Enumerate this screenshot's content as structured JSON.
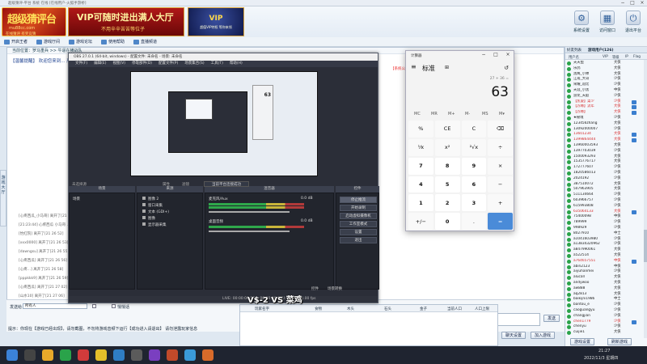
{
  "window": {
    "title": "超级猜评-平台 系统 在线 [在线用户-火狐手游桥]"
  },
  "banner": {
    "logo_title": "超级猜评台",
    "logo_sub": "在线猜评 有奖竞猜",
    "logo_url": "mu88cc.com",
    "ad1_title": "VIP可随时进出满人大厅",
    "ad1_sub": "不用辛辛苦苦等位子",
    "ad2_title": "VIP",
    "ad2_sub": "超值VIP特权 等你来领"
  },
  "topbuttons": [
    "开启王者",
    "游戏厅间",
    "游戏论坛",
    "使用帮助",
    "直播频道"
  ],
  "righttools": [
    {
      "label": "系统设置",
      "icon": "⚙"
    },
    {
      "label": "访问窗口",
      "icon": "▦"
    },
    {
      "label": "退出平台",
      "icon": "⏻"
    }
  ],
  "chat": {
    "breadcrumb": "当前位置：罗马重兵  >>  牛逼在横战队",
    "system_notice": "【温馨提醒】 欢迎您来到... 严禁赌博诈骗...",
    "red_notice": "【系统公告】 ...本平台严禁任何涉赌... 你好 你好，欢迎光临",
    "messages": [
      "[心疼西瓜_小马哥] 离开了[21 26 44]",
      "[21:23:44] 心疼西瓜 小马哥 ...",
      "[怡红院] 离开了[21 26 52]",
      "[xxx0000]  离开了[21 26 53]",
      "[dawngsu] 离开了[21 26 55]",
      "[心疼西瓜] 离开了[21 26 56]",
      "[心疼...] 离开了[21 26 58]",
      "[pppkkk9] 离开了[21 26 59]",
      "[心疼西瓜] 离开了[21 27 02]",
      "[山水10] 离开了[21 27 06]",
      "[一把刀10] 离开了[21 27 08]",
      "[山水10] 离开了[21 27 09]",
      "[玩玩了] 离开了[21 27 12]"
    ]
  },
  "sidetab_label": "游戏大厅",
  "input": {
    "send_to_label": "发送给：",
    "send_to_value": "所有人",
    "whisper_label": "悄悄话",
    "send_button": "发送",
    "hint": "提示：你现在【游戏已经出现】，请勿截图，不勿将游戏音频下运行【成功进入请退出】 请勿泄露玩家信息",
    "btn_emote": "表情",
    "btn_settings": "聊天设置",
    "btn_join": "加入游戏"
  },
  "bottompane": {
    "headers": [
      "玩家名字",
      "食物",
      "木头",
      "石头",
      "金子",
      "当前人口",
      "人口上限"
    ]
  },
  "right": {
    "tabs": [
      "好友列表",
      "游戏用户(126)"
    ],
    "headers": [
      "用户名",
      "VIP",
      "等级",
      "IP",
      "Flag"
    ],
    "users": [
      {
        "name": "天天鱼",
        "level": "大侠",
        "vip": false
      },
      {
        "name": "乐鸽",
        "level": "大侠",
        "vip": false
      },
      {
        "name": "黑鹰_小帅",
        "level": "大侠",
        "vip": false
      },
      {
        "name": "江南_大哥",
        "level": "少侠",
        "vip": false
      },
      {
        "name": "荣耀_逗比",
        "level": "少侠",
        "vip": false
      },
      {
        "name": "天涯_小黑",
        "level": "中侠",
        "vip": false
      },
      {
        "name": "游龙_天庭",
        "level": "少侠",
        "vip": false
      },
      {
        "name": "【凯旋】菜少",
        "level": "少侠",
        "vip": true
      },
      {
        "name": "【苏缘】流年",
        "level": "大侠",
        "vip": true
      },
      {
        "name": "【苏缘】",
        "level": "大侠",
        "vip": true
      },
      {
        "name": "★秘境",
        "level": "少侠",
        "vip": false
      },
      {
        "name": "123456zhang",
        "level": "大侠",
        "vip": false
      },
      {
        "name": "13092000007",
        "level": "少侠",
        "vip": false
      },
      {
        "name": "13601234",
        "level": "大侠",
        "vip": true
      },
      {
        "name": "1399864444",
        "level": "大侠",
        "vip": true
      },
      {
        "name": "13960003593",
        "level": "大侠",
        "vip": false
      },
      {
        "name": "1397703039",
        "level": "少侠",
        "vip": false
      },
      {
        "name": "1500093293",
        "level": "大侠",
        "vip": false
      },
      {
        "name": "1535776717",
        "level": "大侠",
        "vip": false
      },
      {
        "name": "172777607",
        "level": "少侠",
        "vip": false
      },
      {
        "name": "1820586013",
        "level": "少侠",
        "vip": false
      },
      {
        "name": "2024192",
        "level": "少侠",
        "vip": false
      },
      {
        "name": "387510072",
        "level": "大侠",
        "vip": false
      },
      {
        "name": "507963905",
        "level": "大侠",
        "vip": false
      },
      {
        "name": "511134664",
        "level": "少侠",
        "vip": false
      },
      {
        "name": "603966757",
        "level": "少侠",
        "vip": false
      },
      {
        "name": "615993808",
        "level": "少侠",
        "vip": false
      },
      {
        "name": "635064133",
        "level": "大侠",
        "vip": true
      },
      {
        "name": "75400098",
        "level": "中侠",
        "vip": false
      },
      {
        "name": "789999",
        "level": "少侠",
        "vip": false
      },
      {
        "name": "998929",
        "level": "少侠",
        "vip": false
      },
      {
        "name": "8027910",
        "level": "中士",
        "vip": false
      },
      {
        "name": "a1041603980",
        "level": "少侠",
        "vip": false
      },
      {
        "name": "a13834320962",
        "level": "少侠",
        "vip": false
      },
      {
        "name": "a847990061",
        "level": "大侠",
        "vip": false
      },
      {
        "name": "a522514",
        "level": "大侠",
        "vip": false
      },
      {
        "name": "a764657551",
        "level": "中侠",
        "vip": true
      },
      {
        "name": "abin2123",
        "level": "中侠",
        "vip": false
      },
      {
        "name": "aiyuhanmei",
        "level": "少侠",
        "vip": false
      },
      {
        "name": "alucall",
        "level": "大侠",
        "vip": false
      },
      {
        "name": "andywoo",
        "level": "大侠",
        "vip": false
      },
      {
        "name": "aw888",
        "level": "大侠",
        "vip": false
      },
      {
        "name": "aq2813",
        "level": "大侠",
        "vip": false
      },
      {
        "name": "baikijni1986",
        "level": "中士",
        "vip": false
      },
      {
        "name": "bantou_e",
        "level": "少侠",
        "vip": false
      },
      {
        "name": "caoguangyu",
        "level": "少侠",
        "vip": false
      },
      {
        "name": "changjian",
        "level": "少侠",
        "vip": false
      },
      {
        "name": "chen1779",
        "level": "少侠",
        "vip": true
      },
      {
        "name": "chenyu",
        "level": "少侠",
        "vip": false
      },
      {
        "name": "cuijie1",
        "level": "大侠",
        "vip": false
      }
    ],
    "btn_left": "游戏设置",
    "btn_right": "刷新游戏"
  },
  "obs": {
    "title": "OBS 27.0.1 (64-bit, windows) - 配置文件: 未命名 - 场景: 未命名",
    "menu": [
      "文件(F)",
      "编辑(E)",
      "视图(V)",
      "停靠部件(D)",
      "配置文件(P)",
      "场景集合(S)",
      "工具(T)",
      "帮助(H)"
    ],
    "toast": "当前平台连接成功",
    "source_missing": "未选择源",
    "properties_btn": "属性",
    "filters_btn": "滤镜",
    "panels": [
      "场景",
      "来源",
      "混音器",
      "控件"
    ],
    "scene_item": "场景",
    "sources": [
      "图像 2",
      "窗口采集",
      "文本 (GDI+)",
      "图像",
      "显示器采集"
    ],
    "mixer": [
      {
        "name": "麦克风/Aux",
        "db": "0.0 dB"
      },
      {
        "name": "桌面音频",
        "db": "0.0 dB"
      }
    ],
    "controls": [
      "停止推流",
      "开始录制",
      "启动虚拟摄像机",
      "工作室模式",
      "设置",
      "退出"
    ],
    "transition_tabs": [
      "控件",
      "场景转换"
    ],
    "status": "LIVE: 00:00:00   REC: 00:00:00   CPU: 3.1%, 30.00 fps",
    "nested_value": "63"
  },
  "overlay": {
    "vs_text": "V$-2 VS 菜鸡"
  },
  "calculator": {
    "title": "计算器",
    "mode": "标准",
    "mode_icon": "⊞",
    "expression": "27 + 36 =",
    "display": "63",
    "memory": [
      "MC",
      "MR",
      "M+",
      "M-",
      "MS",
      "M▾"
    ],
    "keys": [
      "%",
      "CE",
      "C",
      "⌫",
      "⅟x",
      "x²",
      "²√x",
      "÷",
      "7",
      "8",
      "9",
      "×",
      "4",
      "5",
      "6",
      "−",
      "1",
      "2",
      "3",
      "+",
      "+/−",
      "0",
      ".",
      "="
    ]
  },
  "taskbar": {
    "time": "21:27",
    "date": "2022/11/3 星期四"
  }
}
